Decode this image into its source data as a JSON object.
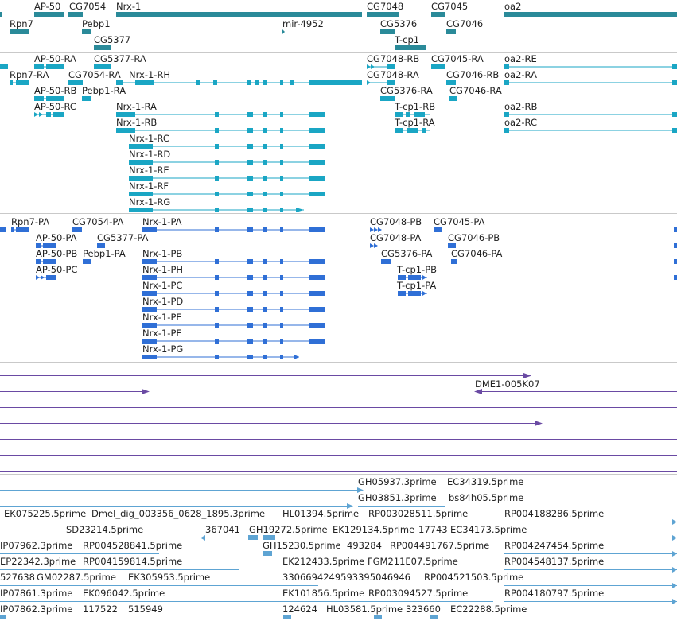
{
  "colors": {
    "gene": "#2a8a99",
    "transcript": "#1aa6c4",
    "protein": "#2f6fd6",
    "clone": "#6a4aa3",
    "est": "#5ea4d3",
    "divider": "#c9c9c9"
  },
  "tracks": {
    "genes": {
      "labels": [
        "AP-50",
        "CG7054",
        "Nrx-1",
        "CG7048",
        "CG7045",
        "oa2",
        "Rpn7",
        "Pebp1",
        "mir-4952",
        "CG5376",
        "CG7046",
        "CG5377",
        "T-cp1"
      ]
    },
    "transcripts": {
      "labels": [
        "AP-50-RA",
        "CG5377-RA",
        "CG7048-RB",
        "CG7045-RA",
        "oa2-RE",
        "Rpn7-RA",
        "CG7054-RA",
        "Nrx-1-RH",
        "CG7048-RA",
        "CG7046-RB",
        "oa2-RA",
        "AP-50-RB",
        "Pebp1-RA",
        "CG5376-RA",
        "CG7046-RA",
        "AP-50-RC",
        "Nrx-1-RA",
        "T-cp1-RB",
        "oa2-RB",
        "Nrx-1-RB",
        "T-cp1-RA",
        "oa2-RC",
        "Nrx-1-RC",
        "Nrx-1-RD",
        "Nrx-1-RE",
        "Nrx-1-RF",
        "Nrx-1-RG"
      ]
    },
    "proteins": {
      "labels": [
        "Rpn7-PA",
        "CG7054-PA",
        "Nrx-1-PA",
        "CG7048-PB",
        "CG7045-PA",
        "AP-50-PA",
        "CG5377-PA",
        "CG7048-PA",
        "CG7046-PB",
        "AP-50-PB",
        "Pebp1-PA",
        "Nrx-1-PB",
        "CG5376-PA",
        "CG7046-PA",
        "AP-50-PC",
        "T-cp1-PB",
        "Nrx-1-PH",
        "T-cp1-PA",
        "Nrx-1-PC",
        "Nrx-1-PD",
        "Nrx-1-PE",
        "Nrx-1-PF",
        "Nrx-1-PG"
      ]
    },
    "clones": {
      "labels": [
        "DME1-005K07"
      ]
    },
    "ests": {
      "labels": [
        "GH05937.3prime",
        "EC34319.5prime",
        "GH03851.3prime",
        "bs84h05.5prime",
        "EK075225.5prime",
        "Dmel_dig_003356_0628_1895.3prime",
        "HL01394.5prime",
        "RP003028511.5prime",
        "SD23214.5prime",
        "367041",
        "GH19272.5prime",
        "EK129134.5prime",
        "17743",
        "EC34173.5prime",
        "RP004188286.5prime",
        "IP07962.3prime",
        "RP004528841.5prime",
        "GH15230.5prime",
        "493284",
        "RP004491767.5prime",
        "RP004247454.5prime",
        "EP22342.3prime",
        "RP004159814.5prime",
        "EK212433.5prime",
        "FGM211E07.5prime",
        "RP004548137.5prime",
        "527638",
        "GM02287.5prime",
        "EK305953.5prime",
        "3306694249593395046946",
        "RP004521503.5prime",
        "IP07861.3prime",
        "EK096042.5prime",
        "EK101856.5prime",
        "RP003094527.5prime",
        "RP004180797.5prime",
        "IP07862.3prime",
        "117522",
        "515949",
        "124624",
        "HL03581.5prime",
        "323660",
        "EC22288.5prime"
      ]
    }
  }
}
